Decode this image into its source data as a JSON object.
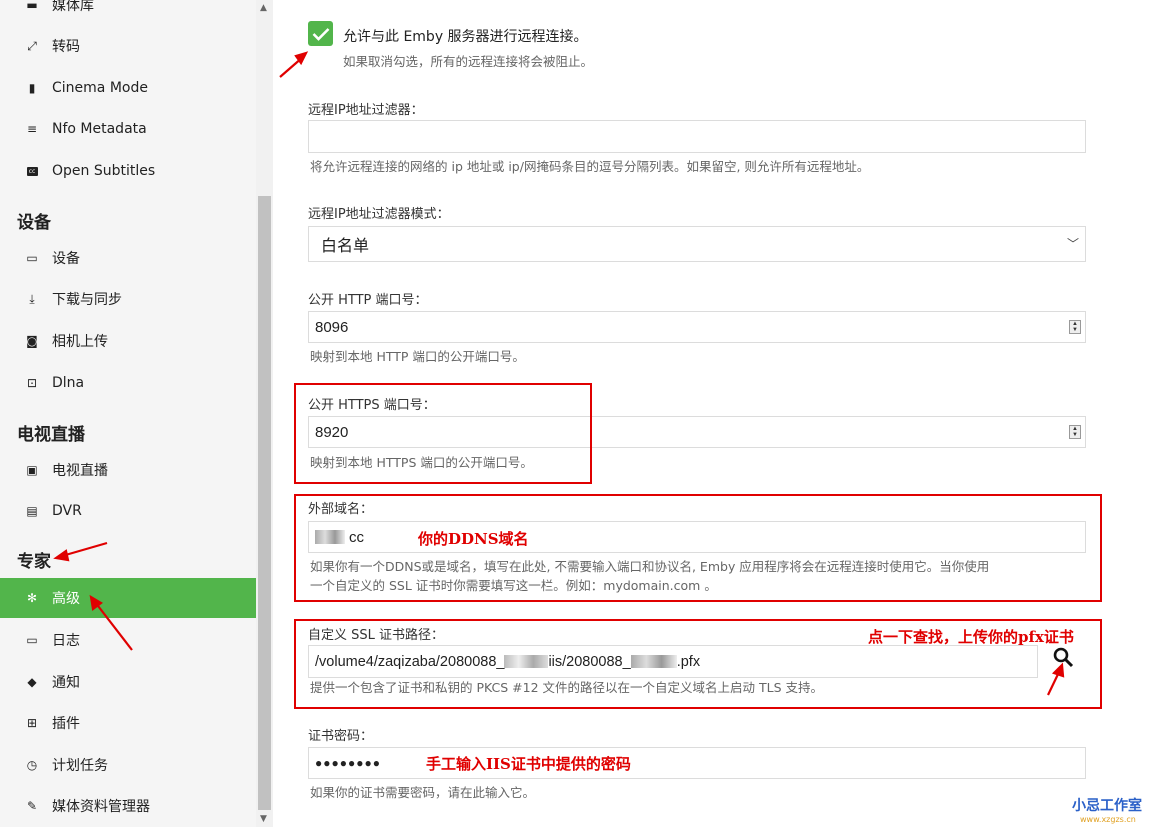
{
  "sidebar": {
    "top_items": [
      {
        "icon": "library-icon",
        "label": "媒体库"
      },
      {
        "icon": "transcode-icon",
        "label": "转码"
      },
      {
        "icon": "film-icon",
        "label": "Cinema Mode"
      },
      {
        "icon": "list-icon",
        "label": "Nfo Metadata"
      },
      {
        "icon": "cc-icon",
        "label": "Open Subtitles"
      }
    ],
    "devices_title": "设备",
    "devices_items": [
      {
        "icon": "devices-icon",
        "label": "设备"
      },
      {
        "icon": "download-icon",
        "label": "下载与同步"
      },
      {
        "icon": "camera-icon",
        "label": "相机上传"
      },
      {
        "icon": "dlna-icon",
        "label": "Dlna"
      }
    ],
    "livetv_title": "电视直播",
    "livetv_items": [
      {
        "icon": "live-tv-icon",
        "label": "电视直播"
      },
      {
        "icon": "dvr-icon",
        "label": "DVR"
      }
    ],
    "expert_title": "专家",
    "expert_items": [
      {
        "icon": "gear-icon",
        "label": "高级"
      },
      {
        "icon": "folder-icon",
        "label": "日志"
      },
      {
        "icon": "bell-icon",
        "label": "通知"
      },
      {
        "icon": "cart-icon",
        "label": "插件"
      },
      {
        "icon": "clock-icon",
        "label": "计划任务"
      },
      {
        "icon": "pencil-icon",
        "label": "媒体资料管理器"
      }
    ]
  },
  "settings": {
    "remote_access_label": "允许与此 Emby 服务器进行远程连接。",
    "remote_access_checked": true,
    "remote_access_help": "如果取消勾选，所有的远程连接将会被阻止。",
    "ip_filter_label": "远程IP地址过滤器：",
    "ip_filter_value": "",
    "ip_filter_help": "将允许远程连接的网络的 ip 地址或 ip/网掩码条目的逗号分隔列表。如果留空, 则允许所有远程地址。",
    "ip_filter_mode_label": "远程IP地址过滤器模式：",
    "ip_filter_mode_value": "白名单",
    "http_port_label": "公开 HTTP 端口号：",
    "http_port_value": "8096",
    "http_port_help": "映射到本地 HTTP 端口的公开端口号。",
    "https_port_label": "公开 HTTPS 端口号：",
    "https_port_value": "8920",
    "https_port_help": "映射到本地 HTTPS 端口的公开端口号。",
    "domain_label": "外部域名：",
    "domain_value": "cc",
    "domain_help_line1": "如果你有一个DDNS或是域名，填写在此处, 不需要输入端口和协议名, Emby 应用程序将会在远程连接时使用它。当你使用",
    "domain_help_line2": "一个自定义的 SSL 证书时你需要填写这一栏。例如：mydomain.com 。",
    "cert_path_label": "自定义 SSL 证书路径：",
    "cert_path_value": "/volume4/zaqizaba/2080088_",
    "cert_path_value_mid": "iis/2080088_",
    "cert_path_value_end": ".pfx",
    "cert_path_help": "提供一个包含了证书和私钥的 PKCS #12 文件的路径以在一个自定义域名上启动 TLS 支持。",
    "cert_password_label": "证书密码：",
    "cert_password_value": "●●●●●●●●",
    "cert_password_help": "如果你的证书需要密码，请在此输入它。"
  },
  "annotations": {
    "domain_note": "你的DDNS域名",
    "cert_note": "点一下查找，上传你的pfx证书",
    "password_note": "手工输入IIS证书中提供的密码"
  },
  "watermark": {
    "text": "小忌工作室",
    "url": "www.xzgzs.cn"
  },
  "colors": {
    "accent": "#52b54b",
    "annotation": "#e00000"
  }
}
